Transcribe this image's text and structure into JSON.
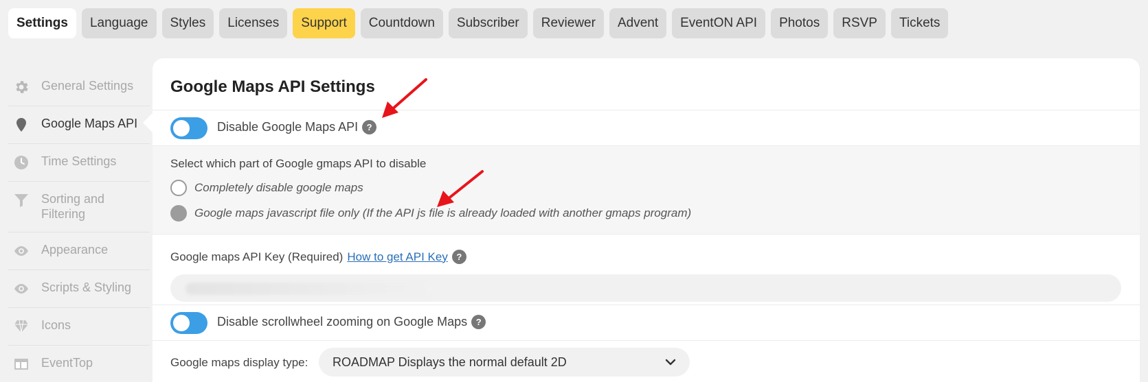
{
  "tabs": [
    {
      "label": "Settings",
      "state": "active"
    },
    {
      "label": "Language"
    },
    {
      "label": "Styles"
    },
    {
      "label": "Licenses"
    },
    {
      "label": "Support",
      "state": "highlight"
    },
    {
      "label": "Countdown"
    },
    {
      "label": "Subscriber"
    },
    {
      "label": "Reviewer"
    },
    {
      "label": "Advent"
    },
    {
      "label": "EventON API"
    },
    {
      "label": "Photos"
    },
    {
      "label": "RSVP"
    },
    {
      "label": "Tickets"
    }
  ],
  "sidebar": {
    "items": [
      {
        "label": "General Settings",
        "icon": "gear-icon"
      },
      {
        "label": "Google Maps API",
        "icon": "map-pin-icon",
        "active": true
      },
      {
        "label": "Time Settings",
        "icon": "clock-icon"
      },
      {
        "label": "Sorting and Filtering",
        "icon": "filter-icon"
      },
      {
        "label": "Appearance",
        "icon": "eye-icon"
      },
      {
        "label": "Scripts & Styling",
        "icon": "eye-icon"
      },
      {
        "label": "Icons",
        "icon": "diamond-icon"
      },
      {
        "label": "EventTop",
        "icon": "layout-icon"
      }
    ]
  },
  "panel": {
    "title": "Google Maps API Settings",
    "disable_api": {
      "label": "Disable Google Maps API",
      "help": "?",
      "enabled": true
    },
    "disable_part": {
      "label": "Select which part of Google gmaps API to disable",
      "options": [
        {
          "label": "Completely disable google maps",
          "checked": false
        },
        {
          "label": "Google maps javascript file only (If the API js file is already loaded with another gmaps program)",
          "checked": true
        }
      ]
    },
    "api_key": {
      "label": "Google maps API Key (Required)",
      "link": "How to get API Key",
      "help": "?",
      "value": ""
    },
    "scrollwheel": {
      "label": "Disable scrollwheel zooming on Google Maps",
      "help": "?",
      "enabled": true
    },
    "display_type": {
      "label": "Google maps display type:",
      "selected": "ROADMAP Displays the normal default 2D"
    }
  },
  "colors": {
    "toggle_on": "#3c9ee5",
    "support_tab": "#fdd34c",
    "annotation_arrow": "#e8141b",
    "link": "#2a6fb8"
  }
}
